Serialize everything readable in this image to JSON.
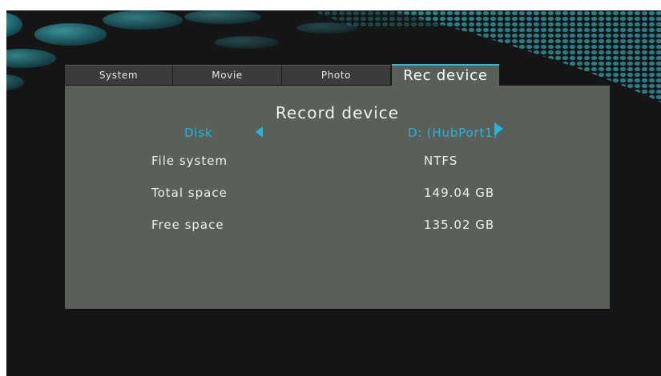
{
  "tabs": [
    {
      "label": "System",
      "active": false
    },
    {
      "label": "Movie",
      "active": false
    },
    {
      "label": "Photo",
      "active": false
    },
    {
      "label": "Rec device",
      "active": true
    }
  ],
  "panel": {
    "title": "Record device",
    "device_selector": {
      "left_value": "Disk",
      "right_value": "D: (HubPort1)"
    },
    "rows": [
      {
        "label": "File system",
        "value": "NTFS"
      },
      {
        "label": "Total space",
        "value": "149.04 GB"
      },
      {
        "label": "Free space",
        "value": "135.02 GB"
      }
    ]
  },
  "colors": {
    "accent": "#1ab8e6",
    "panel_bg": "#5a5f57",
    "tab_bg": "#3a3b3b",
    "screen_bg": "#151515"
  },
  "icons": {
    "prev": "arrow-left-icon",
    "next": "arrow-right-icon"
  }
}
